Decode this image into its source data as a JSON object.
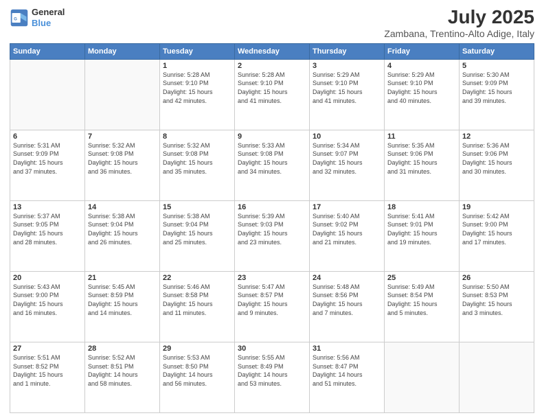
{
  "header": {
    "logo_line1": "General",
    "logo_line2": "Blue",
    "title": "July 2025",
    "subtitle": "Zambana, Trentino-Alto Adige, Italy"
  },
  "days_of_week": [
    "Sunday",
    "Monday",
    "Tuesday",
    "Wednesday",
    "Thursday",
    "Friday",
    "Saturday"
  ],
  "weeks": [
    [
      {
        "day": "",
        "info": ""
      },
      {
        "day": "",
        "info": ""
      },
      {
        "day": "1",
        "info": "Sunrise: 5:28 AM\nSunset: 9:10 PM\nDaylight: 15 hours\nand 42 minutes."
      },
      {
        "day": "2",
        "info": "Sunrise: 5:28 AM\nSunset: 9:10 PM\nDaylight: 15 hours\nand 41 minutes."
      },
      {
        "day": "3",
        "info": "Sunrise: 5:29 AM\nSunset: 9:10 PM\nDaylight: 15 hours\nand 41 minutes."
      },
      {
        "day": "4",
        "info": "Sunrise: 5:29 AM\nSunset: 9:10 PM\nDaylight: 15 hours\nand 40 minutes."
      },
      {
        "day": "5",
        "info": "Sunrise: 5:30 AM\nSunset: 9:09 PM\nDaylight: 15 hours\nand 39 minutes."
      }
    ],
    [
      {
        "day": "6",
        "info": "Sunrise: 5:31 AM\nSunset: 9:09 PM\nDaylight: 15 hours\nand 37 minutes."
      },
      {
        "day": "7",
        "info": "Sunrise: 5:32 AM\nSunset: 9:08 PM\nDaylight: 15 hours\nand 36 minutes."
      },
      {
        "day": "8",
        "info": "Sunrise: 5:32 AM\nSunset: 9:08 PM\nDaylight: 15 hours\nand 35 minutes."
      },
      {
        "day": "9",
        "info": "Sunrise: 5:33 AM\nSunset: 9:08 PM\nDaylight: 15 hours\nand 34 minutes."
      },
      {
        "day": "10",
        "info": "Sunrise: 5:34 AM\nSunset: 9:07 PM\nDaylight: 15 hours\nand 32 minutes."
      },
      {
        "day": "11",
        "info": "Sunrise: 5:35 AM\nSunset: 9:06 PM\nDaylight: 15 hours\nand 31 minutes."
      },
      {
        "day": "12",
        "info": "Sunrise: 5:36 AM\nSunset: 9:06 PM\nDaylight: 15 hours\nand 30 minutes."
      }
    ],
    [
      {
        "day": "13",
        "info": "Sunrise: 5:37 AM\nSunset: 9:05 PM\nDaylight: 15 hours\nand 28 minutes."
      },
      {
        "day": "14",
        "info": "Sunrise: 5:38 AM\nSunset: 9:04 PM\nDaylight: 15 hours\nand 26 minutes."
      },
      {
        "day": "15",
        "info": "Sunrise: 5:38 AM\nSunset: 9:04 PM\nDaylight: 15 hours\nand 25 minutes."
      },
      {
        "day": "16",
        "info": "Sunrise: 5:39 AM\nSunset: 9:03 PM\nDaylight: 15 hours\nand 23 minutes."
      },
      {
        "day": "17",
        "info": "Sunrise: 5:40 AM\nSunset: 9:02 PM\nDaylight: 15 hours\nand 21 minutes."
      },
      {
        "day": "18",
        "info": "Sunrise: 5:41 AM\nSunset: 9:01 PM\nDaylight: 15 hours\nand 19 minutes."
      },
      {
        "day": "19",
        "info": "Sunrise: 5:42 AM\nSunset: 9:00 PM\nDaylight: 15 hours\nand 17 minutes."
      }
    ],
    [
      {
        "day": "20",
        "info": "Sunrise: 5:43 AM\nSunset: 9:00 PM\nDaylight: 15 hours\nand 16 minutes."
      },
      {
        "day": "21",
        "info": "Sunrise: 5:45 AM\nSunset: 8:59 PM\nDaylight: 15 hours\nand 14 minutes."
      },
      {
        "day": "22",
        "info": "Sunrise: 5:46 AM\nSunset: 8:58 PM\nDaylight: 15 hours\nand 11 minutes."
      },
      {
        "day": "23",
        "info": "Sunrise: 5:47 AM\nSunset: 8:57 PM\nDaylight: 15 hours\nand 9 minutes."
      },
      {
        "day": "24",
        "info": "Sunrise: 5:48 AM\nSunset: 8:56 PM\nDaylight: 15 hours\nand 7 minutes."
      },
      {
        "day": "25",
        "info": "Sunrise: 5:49 AM\nSunset: 8:54 PM\nDaylight: 15 hours\nand 5 minutes."
      },
      {
        "day": "26",
        "info": "Sunrise: 5:50 AM\nSunset: 8:53 PM\nDaylight: 15 hours\nand 3 minutes."
      }
    ],
    [
      {
        "day": "27",
        "info": "Sunrise: 5:51 AM\nSunset: 8:52 PM\nDaylight: 15 hours\nand 1 minute."
      },
      {
        "day": "28",
        "info": "Sunrise: 5:52 AM\nSunset: 8:51 PM\nDaylight: 14 hours\nand 58 minutes."
      },
      {
        "day": "29",
        "info": "Sunrise: 5:53 AM\nSunset: 8:50 PM\nDaylight: 14 hours\nand 56 minutes."
      },
      {
        "day": "30",
        "info": "Sunrise: 5:55 AM\nSunset: 8:49 PM\nDaylight: 14 hours\nand 53 minutes."
      },
      {
        "day": "31",
        "info": "Sunrise: 5:56 AM\nSunset: 8:47 PM\nDaylight: 14 hours\nand 51 minutes."
      },
      {
        "day": "",
        "info": ""
      },
      {
        "day": "",
        "info": ""
      }
    ]
  ]
}
